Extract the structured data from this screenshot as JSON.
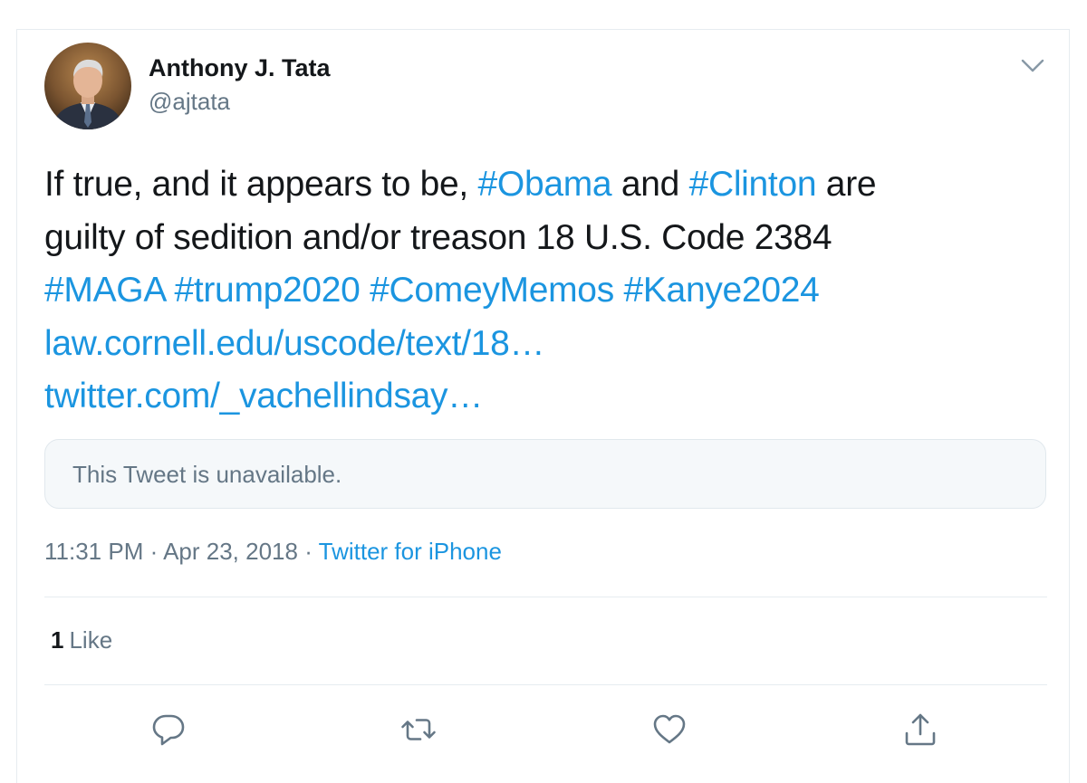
{
  "tweet": {
    "author": {
      "display_name": "Anthony J. Tata",
      "handle": "@ajtata"
    },
    "text_lines": [
      [
        {
          "t": "If true, and it appears to be, ",
          "link": false
        },
        {
          "t": "#Obama",
          "link": true
        },
        {
          "t": " and ",
          "link": false
        },
        {
          "t": "#Clinton",
          "link": true
        },
        {
          "t": " are",
          "link": false
        }
      ],
      [
        {
          "t": "guilty of sedition and/or treason 18 U.S. Code 2384",
          "link": false
        }
      ],
      [
        {
          "t": "#MAGA",
          "link": true
        },
        {
          "t": " ",
          "link": false
        },
        {
          "t": "#trump2020",
          "link": true
        },
        {
          "t": " ",
          "link": false
        },
        {
          "t": "#ComeyMemos",
          "link": true
        },
        {
          "t": " ",
          "link": false
        },
        {
          "t": "#Kanye2024",
          "link": true
        }
      ],
      [
        {
          "t": "law.cornell.edu/uscode/text/18…",
          "link": true
        }
      ],
      [
        {
          "t": "twitter.com/_vachellindsay…",
          "link": true
        }
      ]
    ],
    "quoted_tweet_text": "This Tweet is unavailable.",
    "time": "11:31 PM",
    "separator": "·",
    "date": "Apr 23, 2018",
    "source": "Twitter for iPhone",
    "likes_count": "1",
    "likes_label": "Like"
  },
  "icons": {
    "caret": "chevron-down-icon",
    "reply": "reply-icon",
    "retweet": "retweet-icon",
    "like": "heart-icon",
    "share": "share-icon",
    "avatar": "avatar"
  },
  "colors": {
    "link": "#1b95e0",
    "text": "#14171a",
    "muted": "#657786",
    "border": "#e6ecf0",
    "quote_bg": "#f5f8fa"
  }
}
